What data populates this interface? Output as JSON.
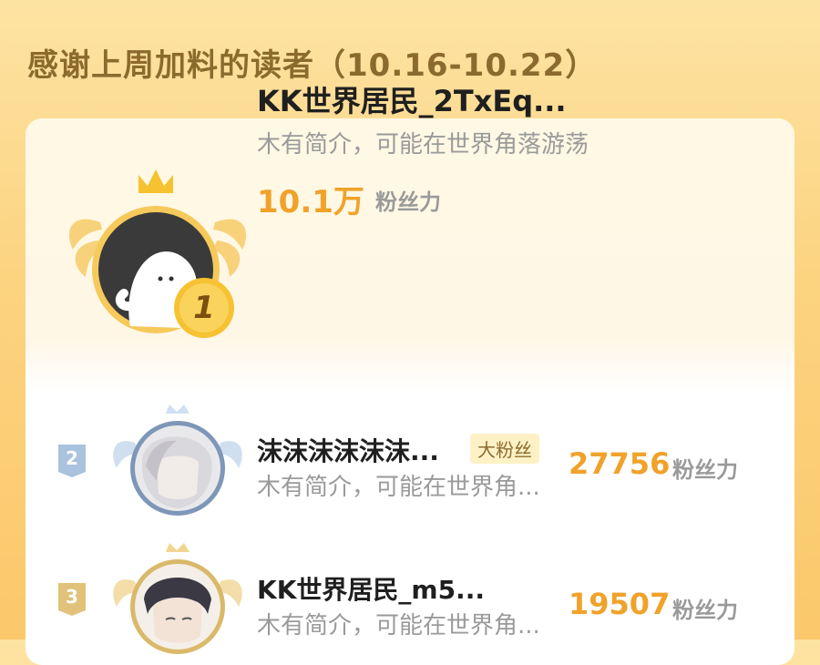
{
  "header": {
    "title": "感谢上周加料的读者（10.16-10.22）"
  },
  "first": {
    "rank": "1",
    "name": "KK世界居民_2TxEq...",
    "bio": "木有简介，可能在世界角落游荡",
    "score": "10.1万",
    "score_unit": "粉丝力"
  },
  "rows": [
    {
      "rank": "2",
      "name": "沫沫沫沫沫沫...",
      "tag": "大粉丝",
      "bio": "木有简介，可能在世界角...",
      "score": "27756",
      "score_unit": "粉丝力"
    },
    {
      "rank": "3",
      "name": "KK世界居民_m5...",
      "bio": "木有简介，可能在世界角...",
      "score": "19507",
      "score_unit": "粉丝力"
    }
  ],
  "icons": {
    "rank1_avatar": "default-ghost-avatar",
    "rank2_avatar": "anime-avatar",
    "rank3_avatar": "anime-avatar"
  },
  "colors": {
    "accent": "#f0a22a",
    "gold": "#f5c347",
    "silver": "#a9c2dd",
    "bronze": "#e0c27a",
    "title": "#8c6a2d"
  }
}
